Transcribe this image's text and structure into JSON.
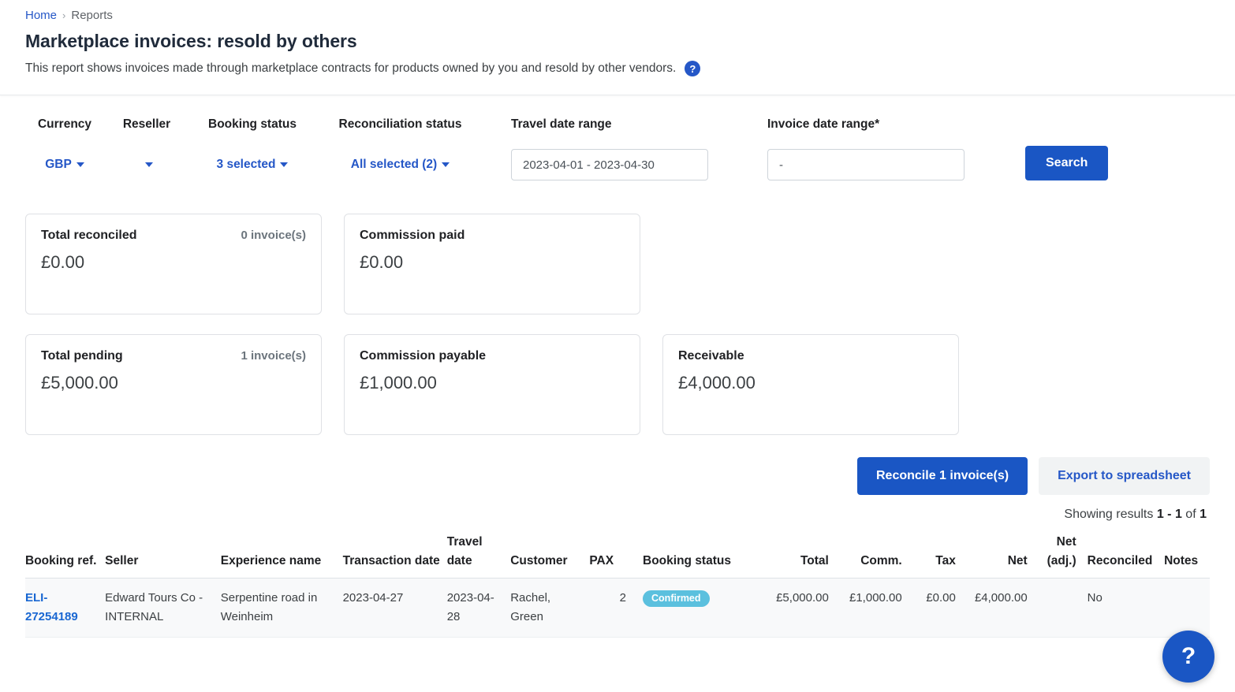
{
  "breadcrumb": {
    "home": "Home",
    "separator": "›",
    "current": "Reports"
  },
  "header": {
    "title": "Marketplace invoices: resold by others",
    "description": "This report shows invoices made through marketplace contracts for products owned by you and resold by other vendors.",
    "help_icon": "?"
  },
  "filters": {
    "currency": {
      "label": "Currency",
      "value": "GBP"
    },
    "reseller": {
      "label": "Reseller",
      "value": ""
    },
    "booking_status": {
      "label": "Booking status",
      "value": "3 selected"
    },
    "reconciliation_status": {
      "label": "Reconciliation status",
      "value": "All selected (2)"
    },
    "travel_date_range": {
      "label": "Travel date range",
      "value": "2023-04-01 - 2023-04-30",
      "placeholder": "-"
    },
    "invoice_date_range": {
      "label": "Invoice date range*",
      "value": "-",
      "placeholder": "-"
    },
    "search_button": "Search"
  },
  "summary_cards": [
    {
      "title": "Total reconciled",
      "count": "0 invoice(s)",
      "value": "£0.00"
    },
    {
      "title": "Commission paid",
      "count": "",
      "value": "£0.00"
    },
    {
      "title": "Total pending",
      "count": "1 invoice(s)",
      "value": "£5,000.00"
    },
    {
      "title": "Commission payable",
      "count": "",
      "value": "£1,000.00"
    },
    {
      "title": "Receivable",
      "count": "",
      "value": "£4,000.00"
    }
  ],
  "actions": {
    "reconcile_button": "Reconcile 1 invoice(s)",
    "export_button": "Export to spreadsheet"
  },
  "results": {
    "prefix": "Showing results",
    "range": "1 - 1",
    "middle": "of",
    "total": "1"
  },
  "table": {
    "columns": [
      "Booking ref.",
      "Seller",
      "Experience name",
      "Transaction date",
      "Travel date",
      "Customer",
      "PAX",
      "Booking status",
      "Total",
      "Comm.",
      "Tax",
      "Net",
      "Net (adj.)",
      "Reconciled",
      "Notes"
    ],
    "rows": [
      {
        "booking_ref": "ELI-27254189",
        "seller": "Edward Tours Co - INTERNAL",
        "experience_name": "Serpentine road in Weinheim",
        "transaction_date": "2023-04-27",
        "travel_date": "2023-04-28",
        "customer": "Rachel, Green",
        "pax": "2",
        "booking_status": "Confirmed",
        "total": "£5,000.00",
        "comm": "£1,000.00",
        "tax": "£0.00",
        "net": "£4,000.00",
        "net_adj": "",
        "reconciled": "No",
        "notes": ""
      }
    ]
  },
  "help_fab": {
    "label": "?"
  },
  "colors": {
    "primary_blue": "#1a56c4",
    "link_blue": "#2557c7",
    "badge_confirmed": "#5bc0de",
    "row_background": "#f8f9fa"
  }
}
